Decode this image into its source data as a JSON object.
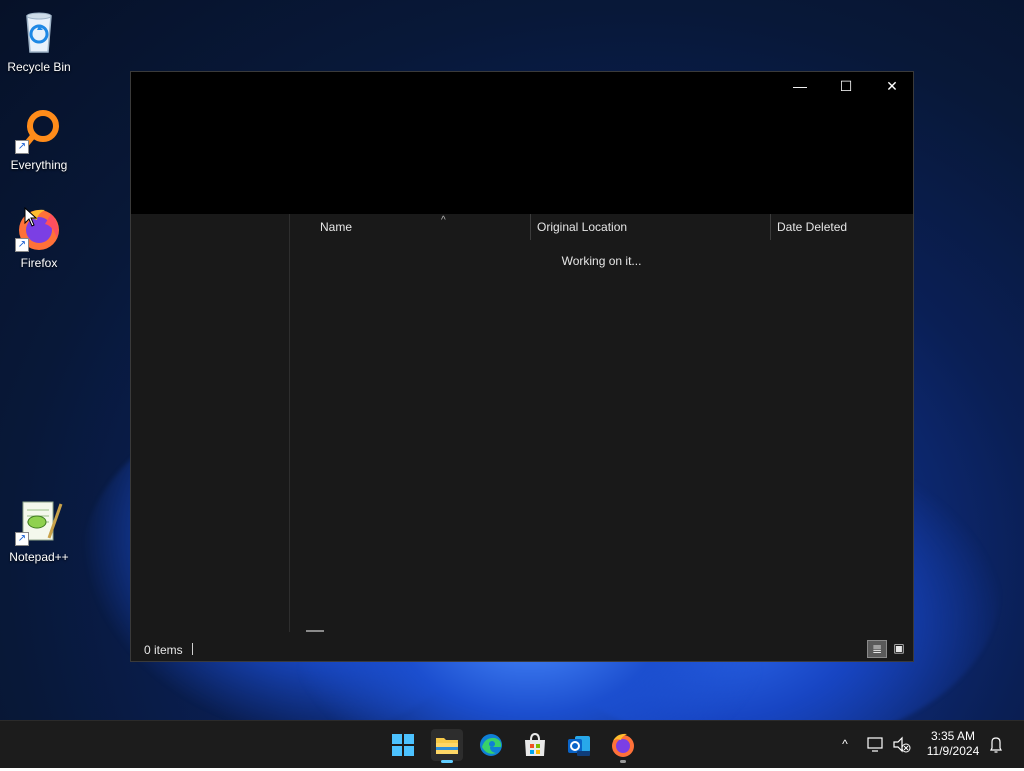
{
  "desktop": {
    "icons": [
      {
        "label": "Recycle Bin",
        "icon": "recycle-bin-icon"
      },
      {
        "label": "Everything",
        "icon": "everything-search-icon"
      },
      {
        "label": "Firefox",
        "icon": "firefox-icon"
      },
      {
        "label": "Notepad++",
        "icon": "notepad-plus-plus-icon"
      }
    ]
  },
  "window": {
    "controls": {
      "minimize": "—",
      "maximize": "☐",
      "close": "✕"
    },
    "columns": {
      "name": "Name",
      "original_location": "Original Location",
      "date_deleted": "Date Deleted"
    },
    "sort_indicator": "^",
    "loading_text": "Working on it...",
    "status": {
      "item_count": "0 items"
    }
  },
  "taskbar": {
    "apps": [
      "start-icon",
      "file-explorer-icon",
      "edge-icon",
      "microsoft-store-icon",
      "outlook-new-icon",
      "firefox-icon"
    ],
    "tray": {
      "chevron": "^",
      "time": "3:35 AM",
      "date": "11/9/2024"
    }
  },
  "colors": {
    "accent": "#60cdff",
    "window_bg": "#191919",
    "taskbar_bg": "#1c1c1c"
  }
}
